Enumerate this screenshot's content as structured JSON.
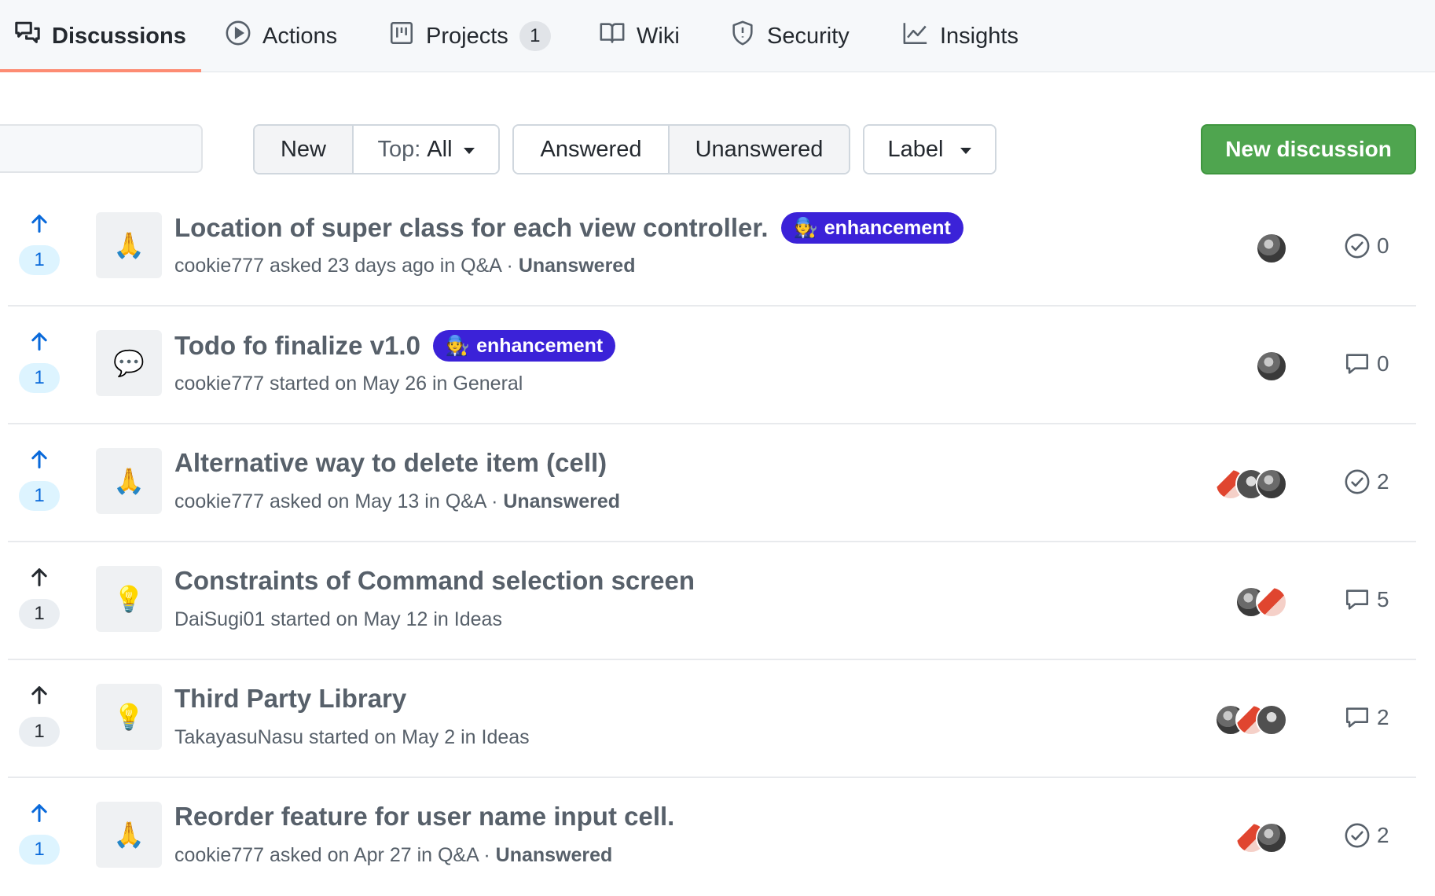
{
  "tabs": [
    {
      "label": "Discussions",
      "icon": "comment-discussion-icon",
      "active": true
    },
    {
      "label": "Actions",
      "icon": "play-circle-icon"
    },
    {
      "label": "Projects",
      "icon": "project-board-icon",
      "count": "1"
    },
    {
      "label": "Wiki",
      "icon": "book-icon"
    },
    {
      "label": "Security",
      "icon": "shield-icon"
    },
    {
      "label": "Insights",
      "icon": "graph-icon"
    }
  ],
  "toolbar": {
    "sort_new": "New",
    "sort_top_prefix": "Top:",
    "sort_top_value": "All",
    "filter_answered": "Answered",
    "filter_unanswered": "Unanswered",
    "label_filter": "Label",
    "new_discussion": "New discussion"
  },
  "discussions": [
    {
      "title": "Location of super class for each view controller.",
      "label": "enhancement",
      "label_emoji": "🧑‍🔧",
      "label_color": "#3b22d8",
      "category_emoji": "🙏",
      "author": "cookie777",
      "action": "asked 23 days ago in",
      "category": "Q&A",
      "separator": "·",
      "status": "Unanswered",
      "votes": "1",
      "voted": true,
      "comment_type": "answer",
      "comments": "0",
      "avatars": [
        "dark"
      ]
    },
    {
      "title": "Todo fo finalize v1.0",
      "label": "enhancement",
      "label_emoji": "🧑‍🔧",
      "label_color": "#3b22d8",
      "category_emoji": "💬",
      "author": "cookie777",
      "action": "started on May 26 in",
      "category": "General",
      "votes": "1",
      "voted": true,
      "comment_type": "comment",
      "comments": "0",
      "avatars": [
        "dark"
      ]
    },
    {
      "title": "Alternative way to delete item (cell)",
      "category_emoji": "🙏",
      "author": "cookie777",
      "action": "asked on May 13 in",
      "category": "Q&A",
      "separator": "·",
      "status": "Unanswered",
      "votes": "1",
      "voted": true,
      "comment_type": "answer",
      "comments": "2",
      "avatars": [
        "red",
        "gray",
        "dark"
      ]
    },
    {
      "title": "Constraints of Command selection screen",
      "category_emoji": "💡",
      "author": "DaiSugi01",
      "action": "started on May 12 in",
      "category": "Ideas",
      "votes": "1",
      "voted": false,
      "comment_type": "comment",
      "comments": "5",
      "avatars": [
        "dark",
        "red"
      ]
    },
    {
      "title": "Third Party Library",
      "category_emoji": "💡",
      "author": "TakayasuNasu",
      "action": "started on May 2 in",
      "category": "Ideas",
      "votes": "1",
      "voted": false,
      "comment_type": "comment",
      "comments": "2",
      "avatars": [
        "dark",
        "red",
        "gray"
      ]
    },
    {
      "title": "Reorder feature for user name input cell.",
      "category_emoji": "🙏",
      "author": "cookie777",
      "action": "asked on Apr 27 in",
      "category": "Q&A",
      "separator": "·",
      "status": "Unanswered",
      "votes": "1",
      "voted": true,
      "comment_type": "answer",
      "comments": "2",
      "avatars": [
        "red",
        "dark"
      ]
    }
  ]
}
